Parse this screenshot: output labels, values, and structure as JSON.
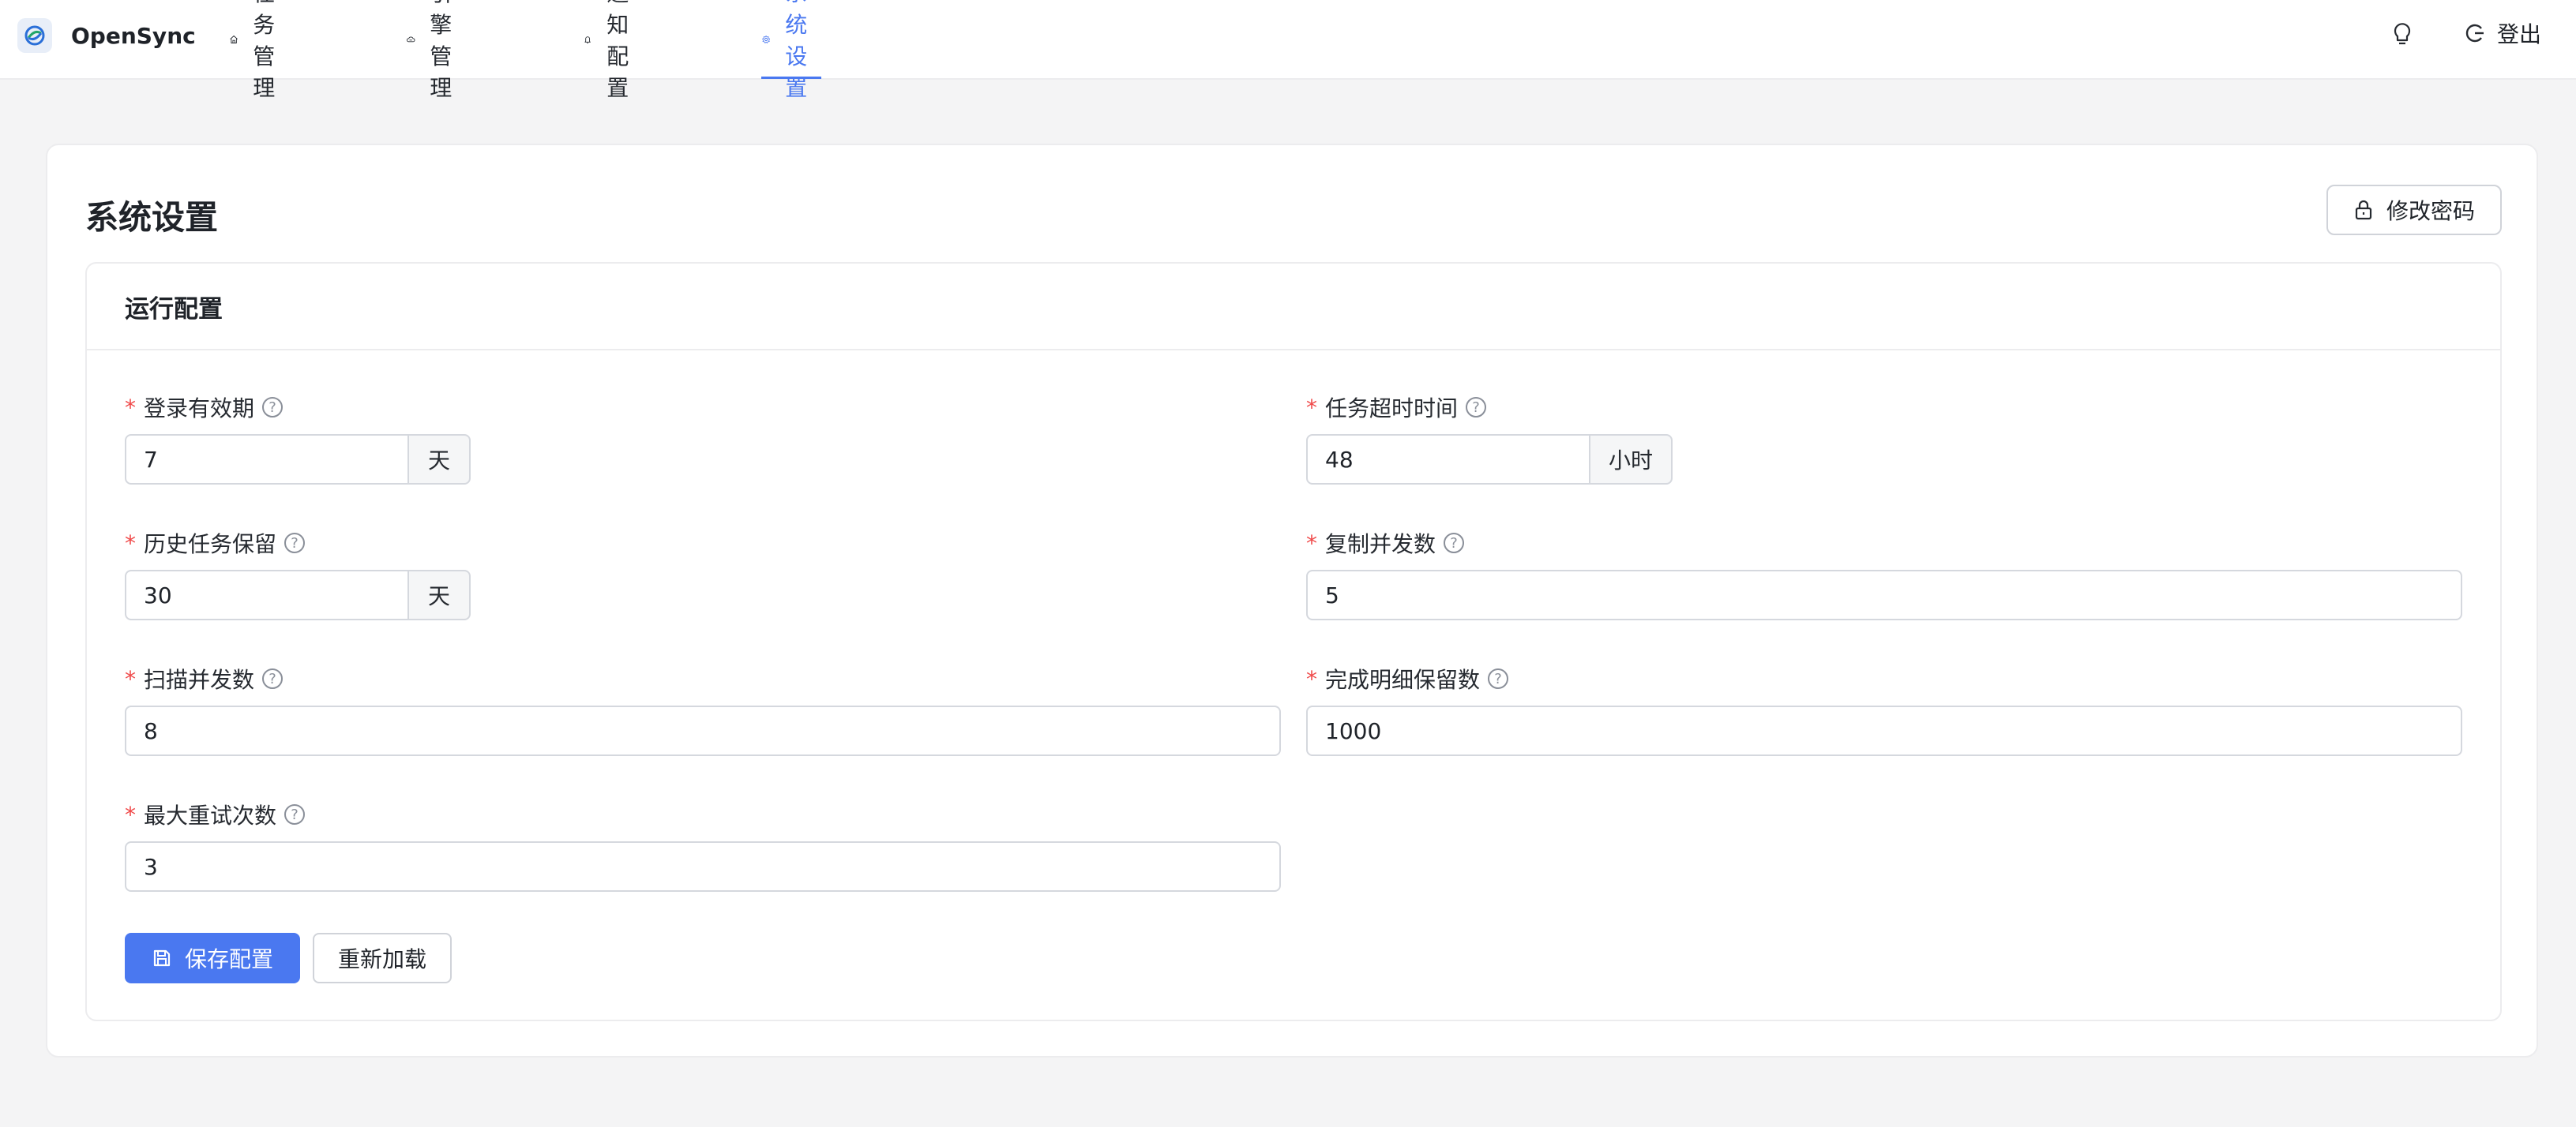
{
  "app": {
    "name": "OpenSync"
  },
  "nav": {
    "items": [
      {
        "label": "任务管理",
        "icon": "home-icon"
      },
      {
        "label": "引擎管理",
        "icon": "cloud-icon"
      },
      {
        "label": "通知配置",
        "icon": "bell-icon"
      },
      {
        "label": "系统设置",
        "icon": "gear-icon",
        "active": true
      }
    ],
    "logout_label": "登出",
    "theme_icon": "lightbulb-icon"
  },
  "page": {
    "title": "系统设置",
    "change_password_label": "修改密码"
  },
  "panel": {
    "title": "运行配置",
    "fields": {
      "login_validity": {
        "label": "登录有效期",
        "value": "7",
        "suffix": "天",
        "required": true
      },
      "task_timeout": {
        "label": "任务超时时间",
        "value": "48",
        "suffix": "小时",
        "required": true
      },
      "history_retention": {
        "label": "历史任务保留",
        "value": "30",
        "suffix": "天",
        "required": true
      },
      "copy_concurrency": {
        "label": "复制并发数",
        "value": "5",
        "required": true
      },
      "scan_concurrency": {
        "label": "扫描并发数",
        "value": "8",
        "required": true
      },
      "detail_retention": {
        "label": "完成明细保留数",
        "value": "1000",
        "required": true
      },
      "max_retries": {
        "label": "最大重试次数",
        "value": "3",
        "required": true
      }
    },
    "required_mark": "*",
    "help_glyph": "?",
    "save_label": "保存配置",
    "reload_label": "重新加载"
  },
  "colors": {
    "accent": "#4a78f0",
    "required": "#f04a4a",
    "background": "#f4f4f5"
  }
}
